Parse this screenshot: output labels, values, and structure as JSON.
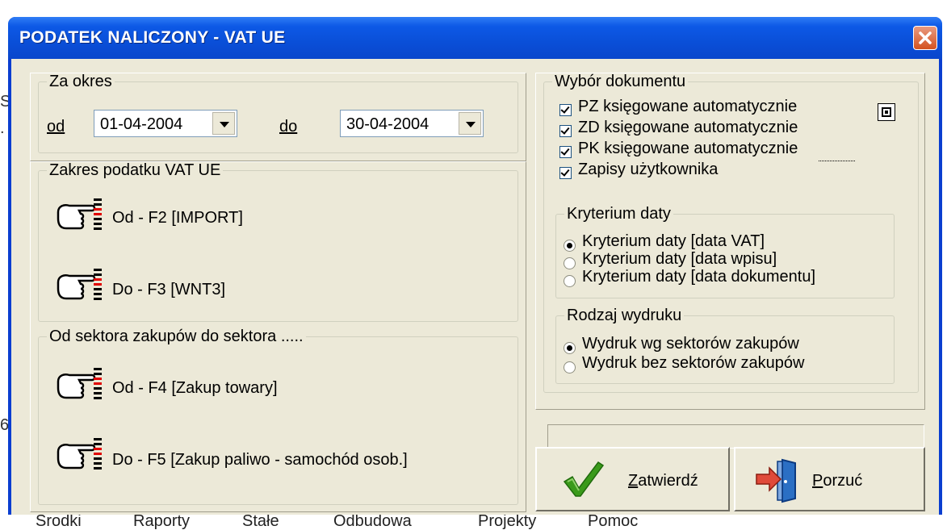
{
  "background": {
    "left_fragments": [
      "S",
      "C",
      "6"
    ],
    "bottom_menu": [
      "Środki",
      "Raporty",
      "Stałe",
      "Odbudowa",
      "Projekty",
      "Pomoc"
    ]
  },
  "window": {
    "title": "PODATEK NALICZONY - VAT UE"
  },
  "za_okres": {
    "legend": "Za okres",
    "od_label": "od",
    "od_value": "01-04-2004",
    "do_label": "do",
    "do_value": "30-04-2004"
  },
  "zakres": {
    "legend": "Zakres podatku VAT UE",
    "od": "Od - F2 [IMPORT]",
    "do": "Do - F3 [WNT3]"
  },
  "sektor": {
    "legend": "Od sektora zakupów do sektora .....",
    "od": "Od - F4 [Zakup towary]",
    "do": "Do - F5 [Zakup paliwo - samochód osob.]"
  },
  "wybor": {
    "legend": "Wybór dokumentu",
    "items": [
      {
        "label": "PZ księgowane automatycznie",
        "checked": true
      },
      {
        "label": "ZD księgowane automatycznie",
        "checked": true
      },
      {
        "label": "PK księgowane automatycznie",
        "checked": true
      },
      {
        "label": "Zapisy użytkownika",
        "checked": true
      }
    ]
  },
  "kryterium": {
    "legend": "Kryterium daty",
    "options": [
      {
        "label": "Kryterium daty  [data VAT]",
        "selected": true
      },
      {
        "label": "Kryterium daty  [data wpisu]",
        "selected": false
      },
      {
        "label": "Kryterium daty  [data dokumentu]",
        "selected": false
      }
    ]
  },
  "rodzaj": {
    "legend": "Rodzaj wydruku",
    "options": [
      {
        "label": "Wydruk wg  sektorów zakupów",
        "selected": true
      },
      {
        "label": "Wydruk bez sektorów zakupów",
        "selected": false
      }
    ]
  },
  "buttons": {
    "confirm": "Zatwierdź",
    "cancel": "Porzuć"
  },
  "colors": {
    "titlebar": "#0a4fd8",
    "dialog_face": "#ece9d8",
    "close_button": "#d3521f",
    "hand_index_red": "#e00000",
    "checkmark_green": "#3a9a1a"
  }
}
